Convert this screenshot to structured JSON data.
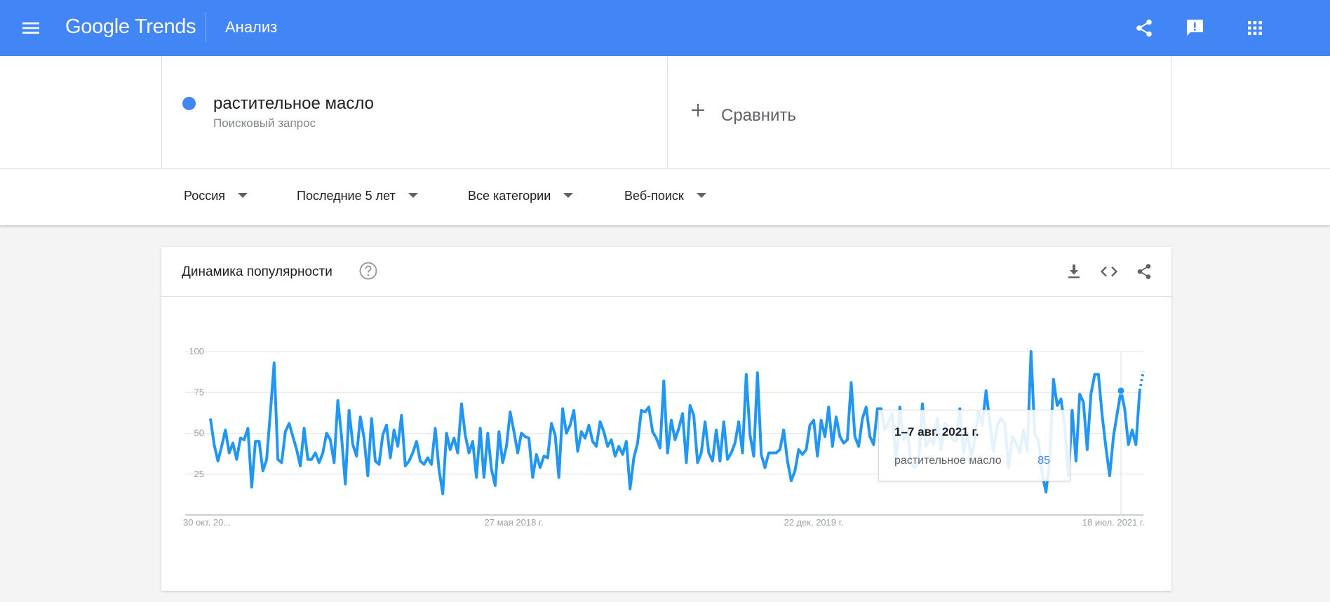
{
  "header": {
    "logo_google": "Google",
    "logo_trends": "Trends",
    "title": "Анализ",
    "icons": [
      "menu-icon",
      "share-icon",
      "feedback-icon",
      "apps-icon"
    ]
  },
  "terms": {
    "term": {
      "label": "растительное масло",
      "type": "Поисковый запрос",
      "color": "#4285f4"
    },
    "compare_label": "Сравнить"
  },
  "filters": {
    "region": "Россия",
    "period": "Последние 5 лет",
    "category": "Все категории",
    "search_type": "Веб-поиск"
  },
  "card": {
    "title": "Динамика популярности",
    "icons": [
      "help-icon",
      "download-icon",
      "embed-icon",
      "share-icon"
    ]
  },
  "tooltip": {
    "date": "1–7 авг. 2021 г.",
    "term": "растительное масло",
    "value": "85"
  },
  "chart_data": {
    "type": "line",
    "title": "",
    "xlabel": "",
    "ylabel": "",
    "ylim": [
      0,
      100
    ],
    "yticks": [
      25,
      50,
      75,
      100
    ],
    "grid": true,
    "x_tick_labels": [
      "30 окт. 20...",
      "27 мая 2018 г.",
      "22 дек. 2019 г.",
      "18 июл. 2021 г."
    ],
    "x_tick_indices": [
      0,
      81,
      161,
      241
    ],
    "series": [
      {
        "name": "растительное масло",
        "color": "#2196f3",
        "partial_last_points": 1,
        "values": [
          59,
          43,
          33,
          42,
          52,
          38,
          44,
          34,
          47,
          46,
          53,
          17,
          45,
          45,
          27,
          34,
          63,
          93,
          34,
          32,
          51,
          56,
          48,
          40,
          30,
          53,
          34,
          34,
          38,
          32,
          38,
          50,
          46,
          32,
          70,
          48,
          19,
          64,
          43,
          36,
          60,
          47,
          24,
          59,
          33,
          31,
          49,
          55,
          35,
          52,
          42,
          61,
          30,
          33,
          38,
          45,
          33,
          31,
          35,
          31,
          53,
          28,
          13,
          50,
          40,
          47,
          38,
          68,
          49,
          38,
          45,
          23,
          53,
          23,
          50,
          28,
          18,
          51,
          32,
          42,
          63,
          51,
          38,
          50,
          48,
          47,
          23,
          37,
          29,
          36,
          35,
          56,
          49,
          23,
          65,
          50,
          55,
          64,
          39,
          51,
          47,
          55,
          45,
          42,
          57,
          51,
          42,
          46,
          36,
          42,
          37,
          45,
          16,
          35,
          44,
          64,
          63,
          66,
          51,
          47,
          41,
          82,
          38,
          58,
          46,
          53,
          62,
          32,
          67,
          61,
          32,
          38,
          57,
          38,
          33,
          52,
          33,
          57,
          34,
          38,
          44,
          57,
          38,
          86,
          49,
          36,
          87,
          37,
          29,
          38,
          38,
          38,
          40,
          52,
          33,
          21,
          27,
          40,
          37,
          40,
          55,
          58,
          36,
          58,
          48,
          66,
          42,
          60,
          48,
          44,
          46,
          81,
          48,
          42,
          59,
          66,
          48,
          43,
          65,
          65,
          52,
          57,
          62,
          31,
          66,
          46,
          52,
          31,
          29,
          33,
          68,
          42,
          47,
          43,
          59,
          40,
          56,
          52,
          46,
          45,
          65,
          38,
          50,
          36,
          46,
          63,
          55,
          76,
          57,
          39,
          55,
          59,
          56,
          29,
          48,
          44,
          38,
          52,
          39,
          100,
          49,
          46,
          25,
          14,
          34,
          83,
          67,
          71,
          54,
          24,
          64,
          33,
          74,
          69,
          40,
          74,
          86,
          86,
          61,
          41,
          24,
          48,
          62,
          76,
          65,
          43,
          52,
          43,
          76,
          88
        ]
      }
    ]
  }
}
